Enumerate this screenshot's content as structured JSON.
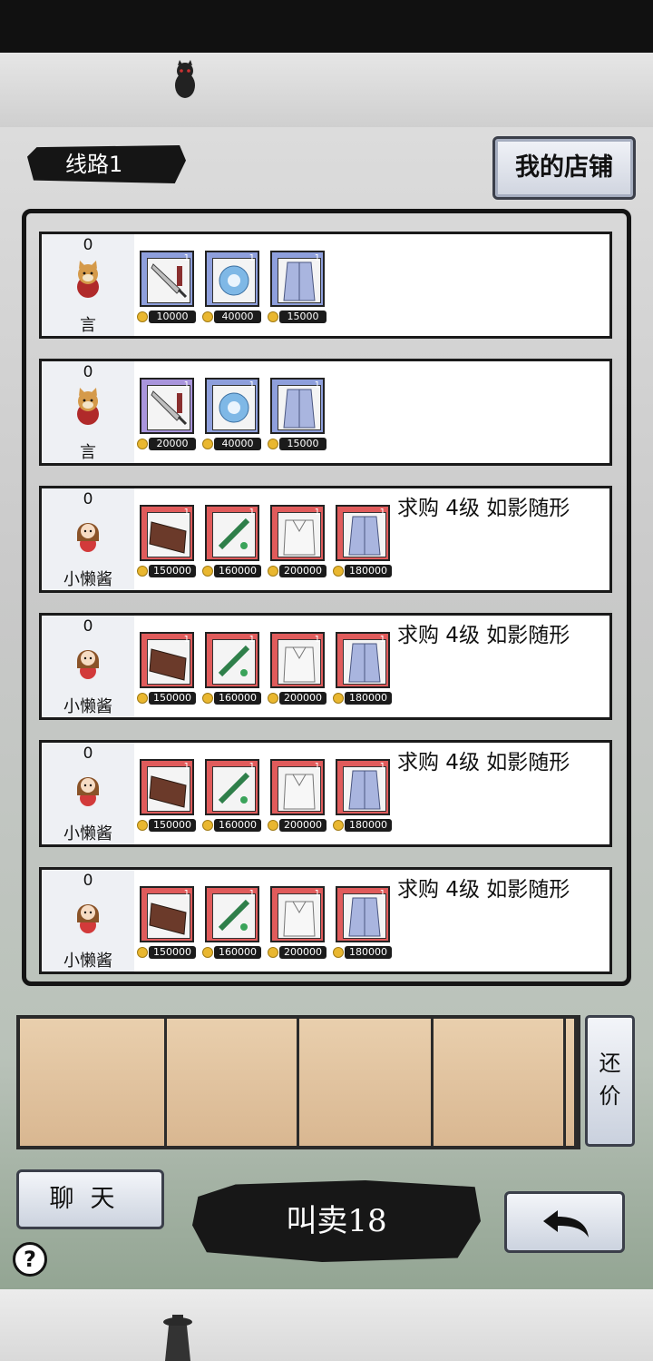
{
  "route": {
    "label": "线路1"
  },
  "header": {
    "my_shop_label": "我的店铺"
  },
  "listings": [
    {
      "count": "0",
      "seller": "言",
      "avatar": "cat-avatar-icon",
      "wanted": "",
      "items": [
        {
          "icon": "sword-icon",
          "rarity": "blue",
          "level": "1",
          "price": "10000"
        },
        {
          "icon": "orb-icon",
          "rarity": "blue",
          "level": "1",
          "price": "40000"
        },
        {
          "icon": "robe-icon",
          "rarity": "blue",
          "level": "1",
          "price": "15000"
        }
      ]
    },
    {
      "count": "0",
      "seller": "言",
      "avatar": "cat-avatar-icon",
      "wanted": "",
      "items": [
        {
          "icon": "sword-icon",
          "rarity": "purple",
          "level": "1",
          "price": "20000"
        },
        {
          "icon": "orb-icon",
          "rarity": "blue",
          "level": "1",
          "price": "40000"
        },
        {
          "icon": "robe-icon",
          "rarity": "blue",
          "level": "1",
          "price": "15000"
        }
      ]
    },
    {
      "count": "0",
      "seller": "小懒酱",
      "avatar": "girl-avatar-icon",
      "wanted": "求购 4级 如影随形",
      "items": [
        {
          "icon": "plank-icon",
          "rarity": "red",
          "level": "1",
          "price": "150000"
        },
        {
          "icon": "flute-icon",
          "rarity": "red",
          "level": "1",
          "price": "160000"
        },
        {
          "icon": "white-robe-icon",
          "rarity": "red",
          "level": "1",
          "price": "200000"
        },
        {
          "icon": "robe-icon",
          "rarity": "red",
          "level": "1",
          "price": "180000"
        }
      ]
    },
    {
      "count": "0",
      "seller": "小懒酱",
      "avatar": "girl-avatar-icon",
      "wanted": "求购 4级 如影随形",
      "items": [
        {
          "icon": "plank-icon",
          "rarity": "red",
          "level": "1",
          "price": "150000"
        },
        {
          "icon": "flute-icon",
          "rarity": "red",
          "level": "1",
          "price": "160000"
        },
        {
          "icon": "white-robe-icon",
          "rarity": "red",
          "level": "1",
          "price": "200000"
        },
        {
          "icon": "robe-icon",
          "rarity": "red",
          "level": "1",
          "price": "180000"
        }
      ]
    },
    {
      "count": "0",
      "seller": "小懒酱",
      "avatar": "girl-avatar-icon",
      "wanted": "求购 4级 如影随形",
      "items": [
        {
          "icon": "plank-icon",
          "rarity": "red",
          "level": "1",
          "price": "150000"
        },
        {
          "icon": "flute-icon",
          "rarity": "red",
          "level": "1",
          "price": "160000"
        },
        {
          "icon": "white-robe-icon",
          "rarity": "red",
          "level": "1",
          "price": "200000"
        },
        {
          "icon": "robe-icon",
          "rarity": "red",
          "level": "1",
          "price": "180000"
        }
      ]
    },
    {
      "count": "0",
      "seller": "小懒酱",
      "avatar": "girl-avatar-icon",
      "wanted": "求购 4级 如影随形",
      "items": [
        {
          "icon": "plank-icon",
          "rarity": "red",
          "level": "1",
          "price": "150000"
        },
        {
          "icon": "flute-icon",
          "rarity": "red",
          "level": "1",
          "price": "160000"
        },
        {
          "icon": "white-robe-icon",
          "rarity": "red",
          "level": "1",
          "price": "200000"
        },
        {
          "icon": "robe-icon",
          "rarity": "red",
          "level": "1",
          "price": "180000"
        }
      ]
    }
  ],
  "counter_offer": {
    "label": "还价",
    "slot_count": 5
  },
  "footer": {
    "chat_label": "聊天",
    "hawk_label": "叫卖18"
  },
  "colors": {
    "blue": "#8e9fdc",
    "purple": "#a995dc",
    "red": "#e05b5b",
    "coin": "#e9b730"
  }
}
